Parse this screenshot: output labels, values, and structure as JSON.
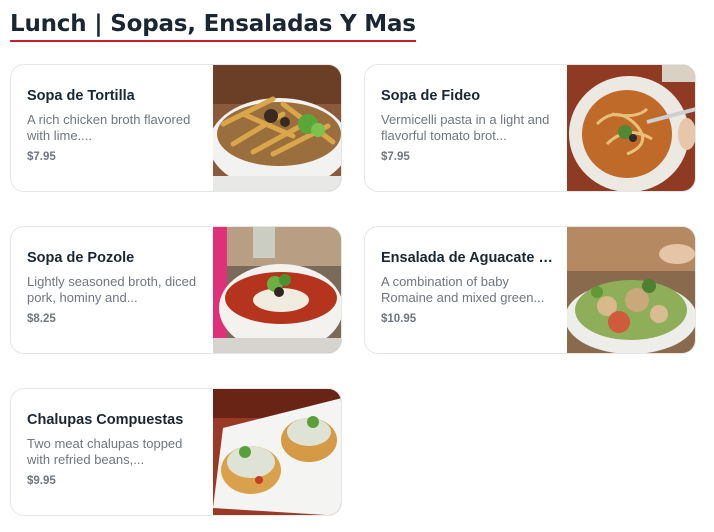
{
  "section": {
    "title": "Lunch | Sopas, Ensaladas Y Mas"
  },
  "items": [
    {
      "name": "Sopa de Tortilla",
      "description": "A rich chicken broth flavored with lime....",
      "price": "$7.95"
    },
    {
      "name": "Sopa de Fideo",
      "description": "Vermicelli pasta in a light and flavorful tomato brot...",
      "price": "$7.95"
    },
    {
      "name": "Sopa de Pozole",
      "description": "Lightly seasoned broth, diced pork, hominy and...",
      "price": "$8.25"
    },
    {
      "name": "Ensalada de Aguacate y L...",
      "description": "A combination of baby Romaine and mixed green...",
      "price": "$10.95"
    },
    {
      "name": "Chalupas Compuestas",
      "description": "Two meat chalupas topped with refried beans,...",
      "price": "$9.95"
    }
  ]
}
